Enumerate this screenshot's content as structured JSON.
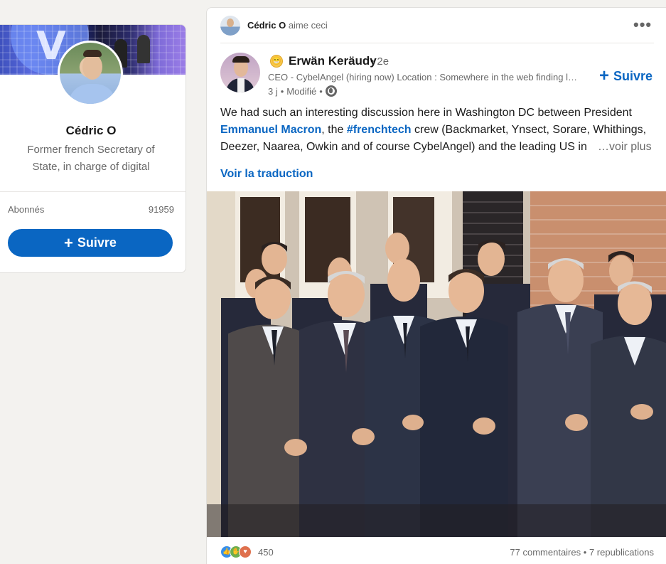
{
  "profile": {
    "name": "Cédric O",
    "headline": "Former french Secretary of State, in charge of digital",
    "followers_label": "Abonnés",
    "followers_count": "91959",
    "follow_label": "Suivre"
  },
  "post": {
    "social_actor": "Cédric O",
    "social_action": "aime ceci",
    "actor_name": "Erwän Keräudy",
    "actor_degree": "• 2e",
    "actor_description": "CEO - CybelAngel (hiring now) Location : Somewhere in the web finding leaks",
    "time": "3 j",
    "edited": "Modifié",
    "follow_label": "Suivre",
    "text_part1": "We had such an interesting discussion here in Washington DC between President ",
    "mention_macron": "Emmanuel Macron",
    "text_part2": ", the ",
    "hashtag": "#frenchtech",
    "text_part3": " crew (Backmarket, Ynsect, Sorare, Whithings, Deezer, Naarea, Owkin and of course CybelAngel) and the leading US in",
    "see_more": "…voir plus",
    "translate": "Voir la traduction",
    "reactions_count": "450",
    "comments": "77 commentaires",
    "separator": "•",
    "shares": "7 republications"
  },
  "icons": {
    "more": "more-dots-icon",
    "globe": "globe-icon",
    "emoji": "grinning-face-icon",
    "reactions": [
      "like-icon",
      "support-icon",
      "love-icon"
    ]
  },
  "colors": {
    "brand_blue": "#0a66c2",
    "background": "#f3f2ef"
  }
}
